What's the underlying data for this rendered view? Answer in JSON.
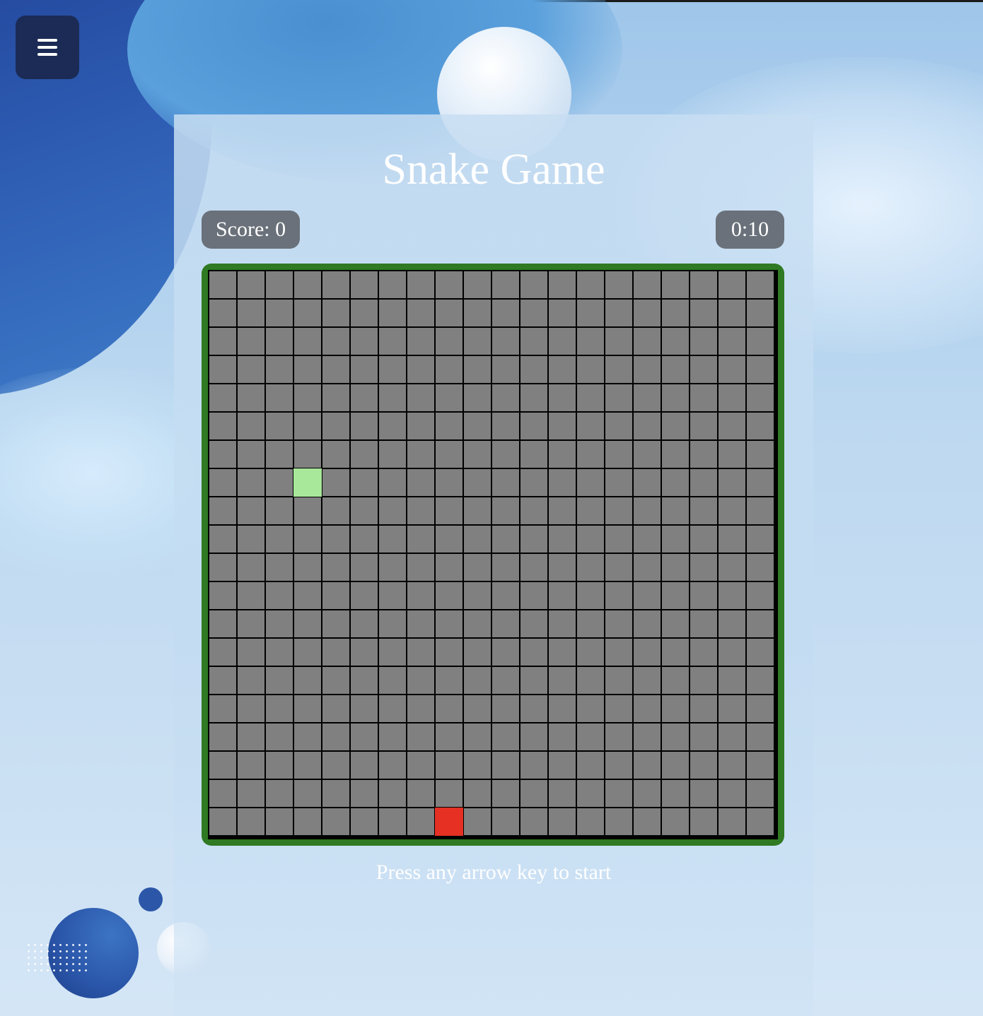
{
  "menu": {
    "icon": "hamburger-menu-icon"
  },
  "header": {
    "title": "Snake Game"
  },
  "hud": {
    "score_label": "Score: 0",
    "timer": "0:10"
  },
  "board": {
    "rows": 20,
    "cols": 20,
    "snake": [
      {
        "row": 7,
        "col": 3
      }
    ],
    "food": {
      "row": 19,
      "col": 8
    },
    "border_color": "#2f7a22",
    "cell_color": "#808080",
    "snake_color": "#a8e89a",
    "food_color": "#e63023"
  },
  "footer": {
    "hint": "Press any arrow key to start"
  }
}
